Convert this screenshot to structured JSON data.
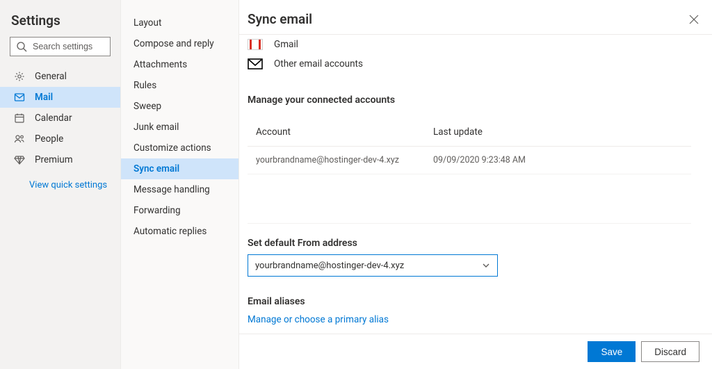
{
  "left": {
    "title": "Settings",
    "search_placeholder": "Search settings",
    "items": [
      {
        "label": "General"
      },
      {
        "label": "Mail"
      },
      {
        "label": "Calendar"
      },
      {
        "label": "People"
      },
      {
        "label": "Premium"
      }
    ],
    "view_quick": "View quick settings"
  },
  "mid": {
    "items": [
      {
        "label": "Layout"
      },
      {
        "label": "Compose and reply"
      },
      {
        "label": "Attachments"
      },
      {
        "label": "Rules"
      },
      {
        "label": "Sweep"
      },
      {
        "label": "Junk email"
      },
      {
        "label": "Customize actions"
      },
      {
        "label": "Sync email"
      },
      {
        "label": "Message handling"
      },
      {
        "label": "Forwarding"
      },
      {
        "label": "Automatic replies"
      }
    ]
  },
  "main": {
    "title": "Sync email",
    "option_gmail": "Gmail",
    "option_other": "Other email accounts",
    "manage_heading": "Manage your connected accounts",
    "table": {
      "head_account": "Account",
      "head_last": "Last update",
      "row_account": "yourbrandname@hostinger-dev-4.xyz",
      "row_last": "09/09/2020 9:23:48 AM"
    },
    "default_heading": "Set default From address",
    "default_value": "yourbrandname@hostinger-dev-4.xyz",
    "aliases_heading": "Email aliases",
    "aliases_link": "Manage or choose a primary alias"
  },
  "footer": {
    "save": "Save",
    "discard": "Discard"
  }
}
